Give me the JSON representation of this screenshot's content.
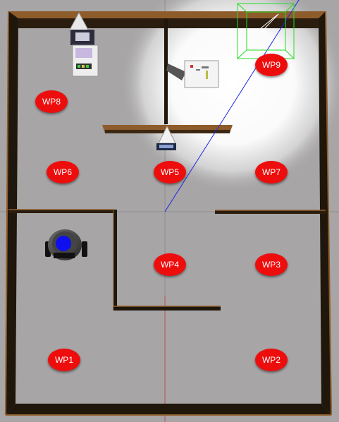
{
  "colors": {
    "background": "#a7a5a6",
    "floor": "#a7a5a6",
    "wall_dark": "#1f160c",
    "wall_edge": "#8e5c2a",
    "waypoint": "#ee0d0d",
    "waypoint_text": "#ffffff",
    "robot_body": "#1010ee",
    "scan_line": "#1a2be0",
    "selection_box": "#22dd22",
    "spotlight": "#ffffff"
  },
  "waypoints": [
    {
      "id": "wp1",
      "label": "WP1"
    },
    {
      "id": "wp2",
      "label": "WP2"
    },
    {
      "id": "wp3",
      "label": "WP3"
    },
    {
      "id": "wp4",
      "label": "WP4"
    },
    {
      "id": "wp5",
      "label": "WP5"
    },
    {
      "id": "wp6",
      "label": "WP6"
    },
    {
      "id": "wp7",
      "label": "WP7"
    },
    {
      "id": "wp8",
      "label": "WP8"
    },
    {
      "id": "wp9",
      "label": "WP9"
    }
  ],
  "icons": {
    "robot": "mobile-robot-icon",
    "cart": "service-cart-icon",
    "table": "table-object-icon",
    "marker": "cone-marker-icon",
    "selection": "selection-box-icon"
  }
}
